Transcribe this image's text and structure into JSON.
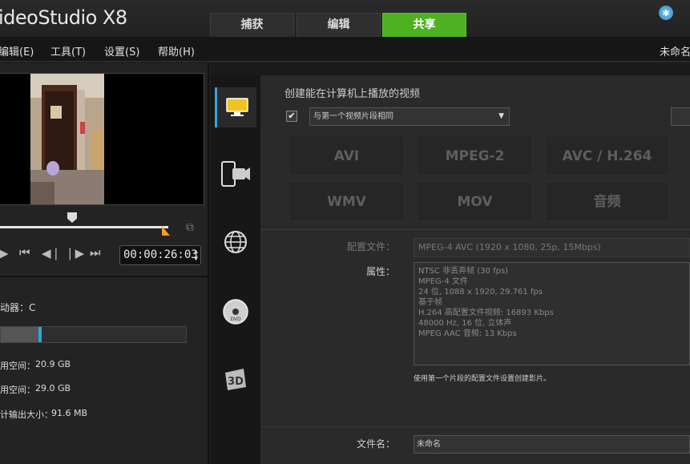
{
  "app": {
    "title": "ideoStudio X8"
  },
  "tabs": [
    {
      "label": "捕获",
      "active": false
    },
    {
      "label": "编辑",
      "active": false
    },
    {
      "label": "共享",
      "active": true
    }
  ],
  "menu": {
    "items": [
      "编辑(E)",
      "工具(T)",
      "设置(S)",
      "帮助(H)"
    ],
    "project_name": "未命名"
  },
  "player": {
    "timecode": "00:00:26:03",
    "scrub_position": 0.43
  },
  "disk": {
    "drive_label": "动器：C",
    "used_fraction": 0.22,
    "stats": [
      {
        "label": "用空间：",
        "value": "20.9 GB"
      },
      {
        "label": "用空间：",
        "value": "29.0 GB"
      },
      {
        "label": "计输出大小：",
        "value": "91.6 MB"
      }
    ]
  },
  "sidebar": {
    "items": [
      {
        "icon": "monitor-icon",
        "active": true
      },
      {
        "icon": "mobile-device-icon",
        "active": false
      },
      {
        "icon": "web-globe-icon",
        "active": false
      },
      {
        "icon": "dvd-disc-icon",
        "active": false
      },
      {
        "icon": "3d-icon",
        "active": false
      }
    ]
  },
  "share": {
    "heading": "创建能在计算机上播放的视频",
    "same_as_first_checked": true,
    "dropdown_value": "与第一个视频片段相同",
    "formats": [
      "AVI",
      "MPEG-2",
      "AVC / H.264",
      "WMV",
      "MOV",
      "音频"
    ],
    "profile_label": "配置文件：",
    "profile_value": "MPEG-4 AVC (1920 x 1080, 25p, 15Mbps)",
    "properties_label": "属性：",
    "properties": [
      "NTSC 非丢弃帧 (30 fps)",
      "MPEG-4 文件",
      "24 位, 1088 x 1920, 29.761 fps",
      "基于帧",
      "H.264 高配置文件视频: 16893 Kbps",
      "48000 Hz, 16 位, 立体声",
      "MPEG AAC 音频: 13 Kbps"
    ],
    "note": "使用第一个片段的配置文件设置创建影片。",
    "filename_label": "文件名：",
    "filename_value": "未命名"
  },
  "colors": {
    "accent_green": "#4fb121",
    "accent_blue": "#2aa7dd",
    "trim_orange": "#f0a020"
  }
}
